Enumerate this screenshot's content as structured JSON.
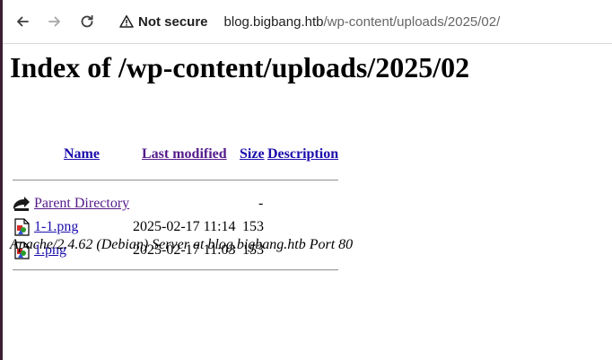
{
  "browser": {
    "security_label": "Not secure",
    "url_host": "blog.bigbang.htb",
    "url_path": "/wp-content/uploads/2025/02/"
  },
  "page": {
    "heading": "Index of /wp-content/uploads/2025/02",
    "columns": {
      "name": "Name",
      "last_modified": "Last modified",
      "size": "Size",
      "description": "Description"
    },
    "rows": [
      {
        "name": "Parent Directory",
        "date": "",
        "size": "-",
        "icon": "back-folder-icon"
      },
      {
        "name": "1-1.png",
        "date": "2025-02-17 11:14",
        "size": "153",
        "icon": "image-file-icon"
      },
      {
        "name": "1.png",
        "date": "2025-02-17 11:03",
        "size": "153",
        "icon": "image-file-icon"
      }
    ],
    "footer": "Apache/2.4.62 (Debian) Server at blog.bigbang.htb Port 80"
  },
  "colors": {
    "link": "#1a0dab",
    "visited_link": "#551a8b"
  }
}
